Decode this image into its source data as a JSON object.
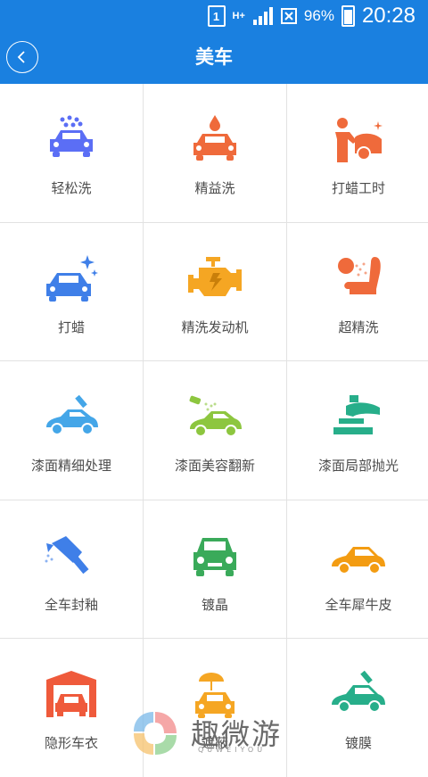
{
  "statusbar": {
    "sim": "1",
    "network": "H+",
    "battery_pct": "96%",
    "time": "20:28"
  },
  "navbar": {
    "title": "美车",
    "back_icon": "chevron-left-icon"
  },
  "services": [
    {
      "label": "轻松洗",
      "icon": "car-wash-icon",
      "color": "#5b6ef5"
    },
    {
      "label": "精益洗",
      "icon": "car-drop-icon",
      "color": "#ef6a3b"
    },
    {
      "label": "打蜡工时",
      "icon": "worker-polish-icon",
      "color": "#ef6a3b"
    },
    {
      "label": "打蜡",
      "icon": "car-sparkle-icon",
      "color": "#3f7fe8"
    },
    {
      "label": "精洗发动机",
      "icon": "engine-icon",
      "color": "#f5a623"
    },
    {
      "label": "超精洗",
      "icon": "seat-spray-icon",
      "color": "#ef6a3b"
    },
    {
      "label": "漆面精细处理",
      "icon": "car-paint-icon",
      "color": "#44a6e8"
    },
    {
      "label": "漆面美容翻新",
      "icon": "car-spray-icon",
      "color": "#8dc63f"
    },
    {
      "label": "漆面局部抛光",
      "icon": "polisher-icon",
      "color": "#27ae8a"
    },
    {
      "label": "全车封釉",
      "icon": "spray-gun-icon",
      "color": "#3f7fe8"
    },
    {
      "label": "镀晶",
      "icon": "car-front-icon",
      "color": "#3aaa5a"
    },
    {
      "label": "全车犀牛皮",
      "icon": "car-side-icon",
      "color": "#f39c12"
    },
    {
      "label": "隐形车衣",
      "icon": "garage-icon",
      "color": "#ef5a3b"
    },
    {
      "label": "遮蔽",
      "icon": "car-umbrella-icon",
      "color": "#f5a623"
    },
    {
      "label": "镀膜",
      "icon": "car-coat-icon",
      "color": "#27ae8a"
    }
  ],
  "watermark": {
    "text": "趣微游",
    "sub": "QUWEIYOU"
  }
}
